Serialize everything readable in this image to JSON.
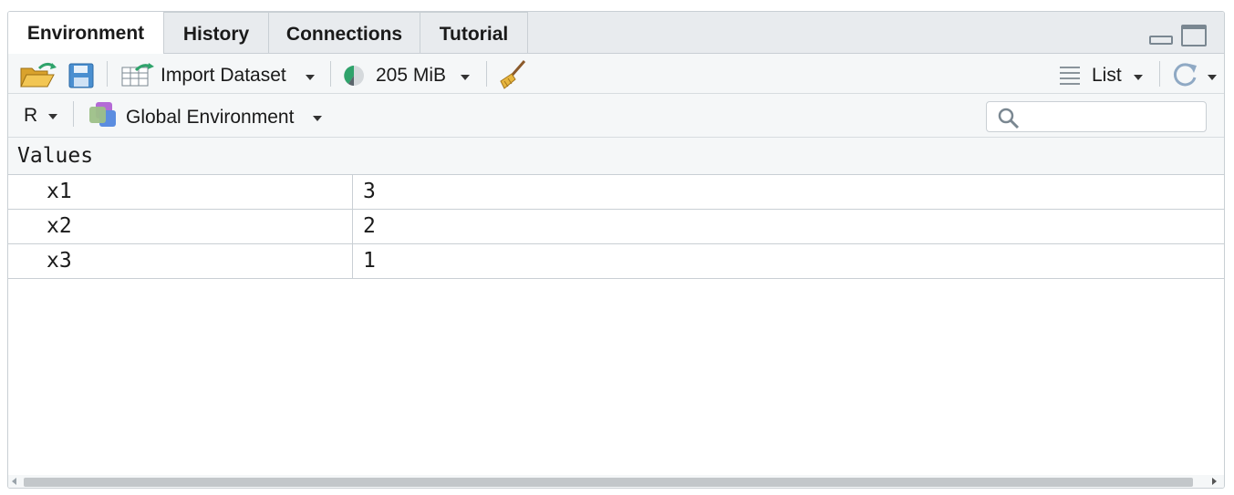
{
  "tabs": [
    {
      "label": "Environment",
      "active": true
    },
    {
      "label": "History",
      "active": false
    },
    {
      "label": "Connections",
      "active": false
    },
    {
      "label": "Tutorial",
      "active": false
    }
  ],
  "toolbar": {
    "import_label": "Import Dataset",
    "memory_label": "205 MiB",
    "view_label": "List"
  },
  "env_bar": {
    "language": "R",
    "environment": "Global Environment",
    "search_placeholder": ""
  },
  "values_section": {
    "title": "Values",
    "rows": [
      {
        "name": "x1",
        "value": "3"
      },
      {
        "name": "x2",
        "value": "2"
      },
      {
        "name": "x3",
        "value": "1"
      }
    ]
  },
  "colors": {
    "toolbar_bg": "#f5f7f8",
    "tab_bg": "#e8ebee",
    "border": "#c9cfd4",
    "accent_green": "#2fa36b",
    "folder_yellow": "#e6b33b",
    "save_blue": "#4a8fd0"
  }
}
